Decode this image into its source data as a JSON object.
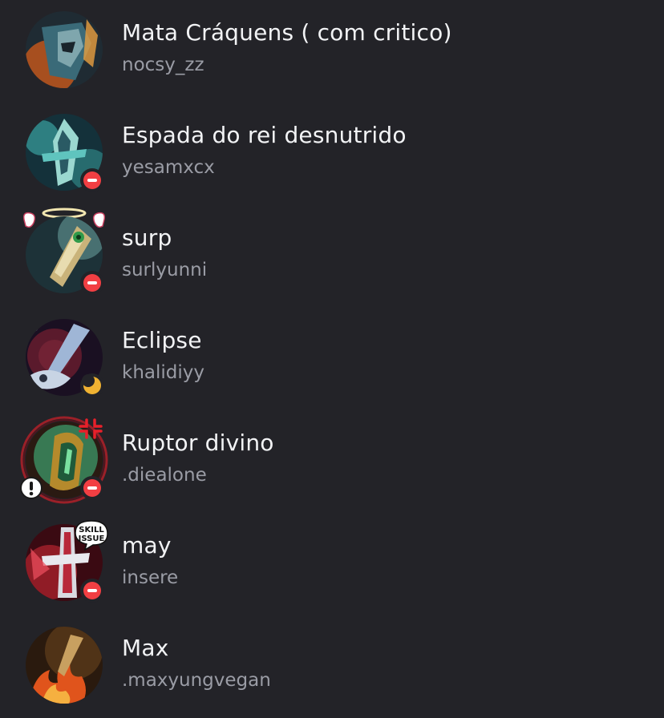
{
  "members": [
    {
      "display_name": "Mata Cráquens ( com critico)",
      "username": "nocsy_zz",
      "status": "none",
      "avatar_icon": "armored-helmet-avatar",
      "colors": [
        "#c0561c",
        "#3a6a78",
        "#1f2b33"
      ]
    },
    {
      "display_name": "Espada do rei desnutrido",
      "username": "yesamxcx",
      "status": "dnd",
      "avatar_icon": "sword-avatar",
      "colors": [
        "#3fb4b0",
        "#14313a",
        "#9bd8d0"
      ]
    },
    {
      "display_name": "surp",
      "username": "surlyunni",
      "status": "dnd",
      "avatar_icon": "sword-avatar",
      "colors": [
        "#5b8a8a",
        "#c9b37a",
        "#1d3238"
      ]
    },
    {
      "display_name": "Eclipse",
      "username": "khalidiyy",
      "status": "idle",
      "avatar_icon": "eclipse-blade-avatar",
      "colors": [
        "#5a1a2c",
        "#9fb6d6",
        "#1a1022"
      ]
    },
    {
      "display_name": "Ruptor divino",
      "username": ".diealone",
      "status": "dnd",
      "avatar_icon": "divine-sunderer-avatar",
      "colors": [
        "#3d9a6a",
        "#b58a2c",
        "#2a1a12"
      ]
    },
    {
      "display_name": "may",
      "username": "insere",
      "status": "dnd",
      "avatar_icon": "crimson-blade-avatar",
      "colors": [
        "#a0202a",
        "#d9d9e0",
        "#3a0a12"
      ],
      "sticker_text": "SKILL ISSUE"
    },
    {
      "display_name": "Max",
      "username": ".maxyungvegan",
      "status": "none",
      "avatar_icon": "flame-blade-avatar",
      "colors": [
        "#e0541c",
        "#f5b040",
        "#2a1a0e"
      ]
    }
  ]
}
